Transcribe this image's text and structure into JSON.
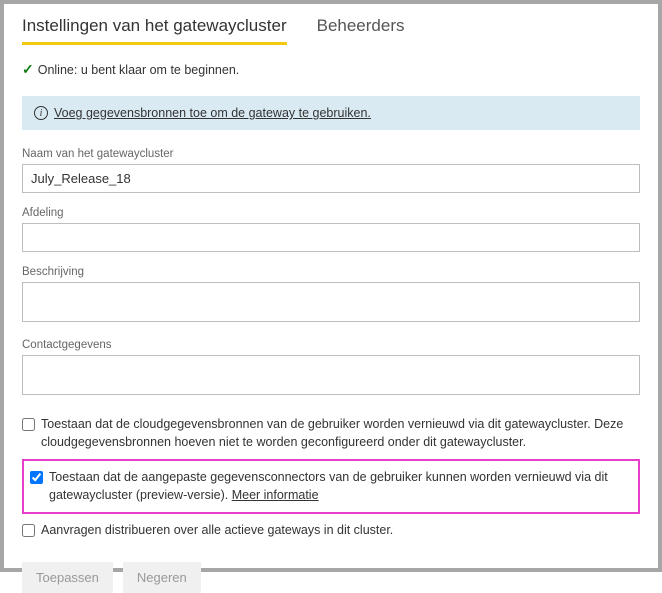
{
  "tabs": {
    "settings": "Instellingen van het gatewaycluster",
    "admins": "Beheerders"
  },
  "status": {
    "text": "Online: u bent klaar om te beginnen."
  },
  "banner": {
    "link_text": "Voeg gegevensbronnen toe om de gateway te gebruiken."
  },
  "fields": {
    "cluster_name_label": "Naam van het gatewaycluster",
    "cluster_name_value": "July_Release_18",
    "department_label": "Afdeling",
    "department_value": "",
    "description_label": "Beschrijving",
    "description_value": "",
    "contact_label": "Contactgegevens",
    "contact_value": ""
  },
  "checkboxes": {
    "cloud_refresh": "Toestaan dat de cloudgegevensbronnen van de gebruiker worden vernieuwd via dit gatewaycluster. Deze cloudgegevensbronnen hoeven niet te worden geconfigureerd onder dit gatewaycluster.",
    "custom_connectors_pre": "Toestaan dat de aangepaste gegevensconnectors van de gebruiker kunnen worden vernieuwd via dit gatewaycluster (preview-versie). ",
    "custom_connectors_link": "Meer informatie",
    "distribute": "Aanvragen distribueren over alle actieve gateways in dit cluster."
  },
  "buttons": {
    "apply": "Toepassen",
    "discard": "Negeren"
  }
}
